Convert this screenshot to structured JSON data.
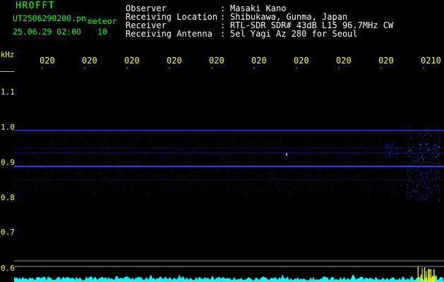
{
  "header": {
    "brand": "HROFFT",
    "filename": "UT2506290200.pn",
    "meteor_label": "meteor",
    "datetime": "25.06.29 02:00",
    "meteor_count": "10"
  },
  "info": [
    {
      "label": "Observer",
      "value": "Masaki Kano"
    },
    {
      "label": "Receiving Location",
      "value": "Shibukawa, Gunma, Japan"
    },
    {
      "label": "Receiver",
      "value": "RTL-SDR SDR# 43dB L15 96.7MHz CW"
    },
    {
      "label": "Receiving Antenna",
      "value": "5el Yagi Az 280 for Seoul"
    }
  ],
  "colon": ":",
  "freq_axis": {
    "unit": "kHz",
    "labels": [
      "1.1",
      "1.0",
      "0.9",
      "0.8",
      "0.7",
      "0.6"
    ]
  },
  "time_axis": {
    "labels": [
      "020",
      "020",
      "020",
      "020",
      "020",
      "020",
      "020",
      "020",
      "020",
      "0210"
    ]
  },
  "colors": {
    "header_text": "#17ff17",
    "info_text": "#ffffff",
    "axis_label_text": "#ffff33",
    "signal": "#2a3cff",
    "amplitude_trace": "#00ffff",
    "amplitude_peak": "#ffff00"
  }
}
